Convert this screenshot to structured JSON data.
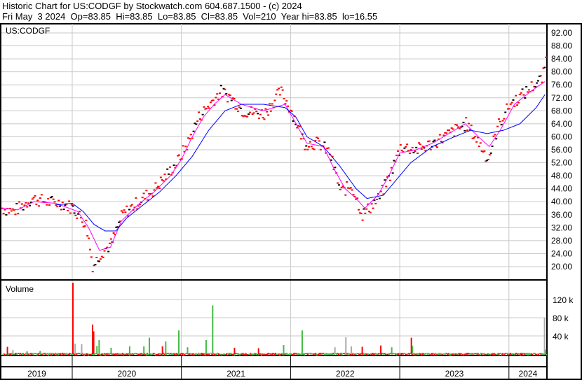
{
  "header": {
    "title": "Historic Chart for US:CODGF by Stockwatch.com 604.687.1500 - (c) 2024",
    "quote": "Fri May  3 2024  Op=83.85  Hi=83.85  Lo=83.85  Cl=83.85  Vol=210  Year hi=83.85  lo=16.55"
  },
  "chart_data": {
    "type": "line",
    "symbol": "US:CODGF",
    "volume_label": "Volume",
    "price_ticks": [
      20,
      24,
      28,
      32,
      36,
      40,
      44,
      48,
      52,
      56,
      60,
      64,
      68,
      72,
      76,
      80,
      84,
      88,
      92
    ],
    "price_tick_labels": [
      "20.00",
      "24.00",
      "28.00",
      "32.00",
      "36.00",
      "40.00",
      "44.00",
      "48.00",
      "52.00",
      "56.00",
      "60.00",
      "64.00",
      "68.00",
      "72.00",
      "76.00",
      "80.00",
      "84.00",
      "88.00",
      "92.00"
    ],
    "volume_ticks": [
      40,
      80,
      120
    ],
    "volume_tick_labels": [
      "40 k",
      "80 k",
      "120 k"
    ],
    "years": [
      "2019",
      "2020",
      "2021",
      "2022",
      "2023",
      "2024"
    ],
    "xlim": [
      2019.35,
      2024.35
    ],
    "ylim": [
      16,
      94
    ],
    "price": [
      [
        2019.35,
        38
      ],
      [
        2019.45,
        37
      ],
      [
        2019.55,
        39
      ],
      [
        2019.62,
        41
      ],
      [
        2019.75,
        40
      ],
      [
        2019.9,
        39.5
      ],
      [
        2020.0,
        38
      ],
      [
        2020.12,
        33
      ],
      [
        2020.18,
        20
      ],
      [
        2020.25,
        24
      ],
      [
        2020.35,
        27
      ],
      [
        2020.45,
        36
      ],
      [
        2020.6,
        40
      ],
      [
        2020.75,
        44
      ],
      [
        2020.85,
        48
      ],
      [
        2020.95,
        52
      ],
      [
        2021.05,
        58
      ],
      [
        2021.15,
        66
      ],
      [
        2021.25,
        70
      ],
      [
        2021.35,
        74
      ],
      [
        2021.45,
        72
      ],
      [
        2021.55,
        68
      ],
      [
        2021.75,
        67
      ],
      [
        2021.9,
        74
      ],
      [
        2022.0,
        68
      ],
      [
        2022.12,
        58
      ],
      [
        2022.25,
        58
      ],
      [
        2022.35,
        55
      ],
      [
        2022.45,
        43
      ],
      [
        2022.55,
        45
      ],
      [
        2022.65,
        36
      ],
      [
        2022.8,
        41
      ],
      [
        2022.9,
        48
      ],
      [
        2023.0,
        57
      ],
      [
        2023.15,
        56
      ],
      [
        2023.3,
        58
      ],
      [
        2023.45,
        61
      ],
      [
        2023.6,
        64
      ],
      [
        2023.72,
        58
      ],
      [
        2023.8,
        53
      ],
      [
        2023.9,
        64
      ],
      [
        2024.0,
        70
      ],
      [
        2024.12,
        73
      ],
      [
        2024.22,
        76
      ],
      [
        2024.3,
        78
      ],
      [
        2024.33,
        83.85
      ]
    ],
    "series": [
      {
        "name": "short MA",
        "color": "#ff00ff",
        "values": [
          [
            2019.35,
            38
          ],
          [
            2019.5,
            37.5
          ],
          [
            2019.65,
            40
          ],
          [
            2019.85,
            39.5
          ],
          [
            2020.05,
            37
          ],
          [
            2020.15,
            32
          ],
          [
            2020.25,
            25
          ],
          [
            2020.35,
            26
          ],
          [
            2020.45,
            34
          ],
          [
            2020.6,
            39
          ],
          [
            2020.75,
            43
          ],
          [
            2020.9,
            48
          ],
          [
            2021.0,
            53
          ],
          [
            2021.1,
            60
          ],
          [
            2021.2,
            66
          ],
          [
            2021.3,
            70
          ],
          [
            2021.4,
            73
          ],
          [
            2021.55,
            70
          ],
          [
            2021.75,
            68
          ],
          [
            2021.95,
            70
          ],
          [
            2022.05,
            64
          ],
          [
            2022.15,
            58
          ],
          [
            2022.3,
            57
          ],
          [
            2022.4,
            50
          ],
          [
            2022.5,
            44
          ],
          [
            2022.6,
            41
          ],
          [
            2022.68,
            38
          ],
          [
            2022.8,
            42
          ],
          [
            2022.9,
            48
          ],
          [
            2023.0,
            55
          ],
          [
            2023.15,
            56
          ],
          [
            2023.3,
            58
          ],
          [
            2023.45,
            61
          ],
          [
            2023.6,
            64
          ],
          [
            2023.72,
            60
          ],
          [
            2023.82,
            57
          ],
          [
            2023.92,
            62
          ],
          [
            2024.05,
            70
          ],
          [
            2024.2,
            74
          ],
          [
            2024.33,
            77
          ]
        ]
      },
      {
        "name": "long MA",
        "color": "#0000ff",
        "values": [
          [
            2019.85,
            39
          ],
          [
            2020.0,
            39.5
          ],
          [
            2020.1,
            37
          ],
          [
            2020.2,
            33
          ],
          [
            2020.3,
            31
          ],
          [
            2020.4,
            31
          ],
          [
            2020.5,
            35
          ],
          [
            2020.65,
            39
          ],
          [
            2020.8,
            43
          ],
          [
            2020.95,
            48
          ],
          [
            2021.1,
            54
          ],
          [
            2021.25,
            62
          ],
          [
            2021.4,
            68
          ],
          [
            2021.55,
            70
          ],
          [
            2021.75,
            70
          ],
          [
            2021.95,
            69
          ],
          [
            2022.05,
            66
          ],
          [
            2022.15,
            60
          ],
          [
            2022.3,
            57
          ],
          [
            2022.45,
            51
          ],
          [
            2022.6,
            44
          ],
          [
            2022.7,
            41
          ],
          [
            2022.85,
            42
          ],
          [
            2022.95,
            46
          ],
          [
            2023.1,
            52
          ],
          [
            2023.3,
            57
          ],
          [
            2023.5,
            60
          ],
          [
            2023.65,
            62
          ],
          [
            2023.8,
            61
          ],
          [
            2023.95,
            62
          ],
          [
            2024.1,
            64
          ],
          [
            2024.25,
            69
          ],
          [
            2024.33,
            73
          ]
        ]
      }
    ],
    "volume": [
      [
        2019.4,
        16,
        "red"
      ],
      [
        2019.45,
        9,
        "gray"
      ],
      [
        2019.58,
        6,
        "green"
      ],
      [
        2019.7,
        7,
        "green"
      ],
      [
        2020.0,
        157,
        "red"
      ],
      [
        2020.02,
        23,
        "gray"
      ],
      [
        2020.08,
        22,
        "gray"
      ],
      [
        2020.18,
        65,
        "red"
      ],
      [
        2020.19,
        50,
        "red"
      ],
      [
        2020.22,
        18,
        "green"
      ],
      [
        2020.24,
        31,
        "green"
      ],
      [
        2020.35,
        14,
        "green"
      ],
      [
        2020.52,
        17,
        "green"
      ],
      [
        2020.65,
        17,
        "green"
      ],
      [
        2020.7,
        36,
        "green"
      ],
      [
        2020.82,
        17,
        "red"
      ],
      [
        2020.85,
        28,
        "green"
      ],
      [
        2020.97,
        52,
        "green"
      ],
      [
        2021.05,
        15,
        "green"
      ],
      [
        2021.22,
        31,
        "green"
      ],
      [
        2021.28,
        107,
        "green"
      ],
      [
        2021.48,
        14,
        "red"
      ],
      [
        2021.7,
        13,
        "red"
      ],
      [
        2021.93,
        20,
        "green"
      ],
      [
        2022.1,
        52,
        "green"
      ],
      [
        2022.4,
        15,
        "gray"
      ],
      [
        2022.5,
        37,
        "gray"
      ],
      [
        2022.55,
        17,
        "gray"
      ],
      [
        2022.65,
        16,
        "red"
      ],
      [
        2022.82,
        19,
        "red"
      ],
      [
        2022.92,
        15,
        "green"
      ],
      [
        2023.1,
        36,
        "red"
      ],
      [
        2023.11,
        18,
        "green"
      ],
      [
        2024.32,
        80,
        "gray"
      ],
      [
        2024.33,
        10,
        "green"
      ]
    ]
  },
  "colors": {
    "up": "#00aa00",
    "down": "#ff0000",
    "grid": "#c8c8c8"
  }
}
